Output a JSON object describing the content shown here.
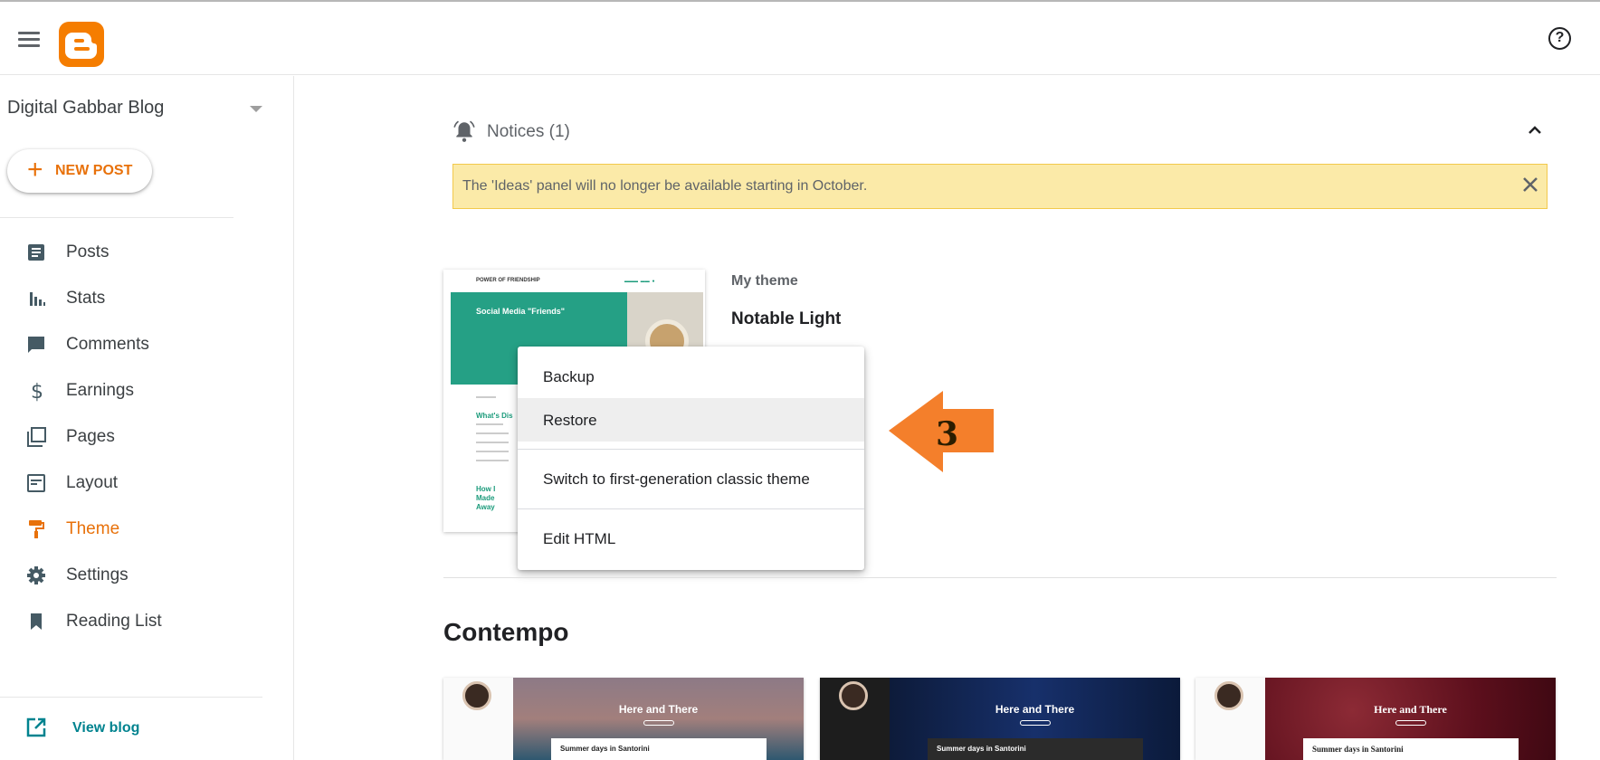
{
  "header": {
    "logo_letter": "B",
    "help_glyph": "?"
  },
  "sidebar": {
    "blog_name": "Digital Gabbar Blog",
    "new_post_label": "NEW POST",
    "items": [
      {
        "label": "Posts",
        "icon": "posts-icon"
      },
      {
        "label": "Stats",
        "icon": "stats-icon"
      },
      {
        "label": "Comments",
        "icon": "comments-icon"
      },
      {
        "label": "Earnings",
        "icon": "dollar-icon"
      },
      {
        "label": "Pages",
        "icon": "pages-icon"
      },
      {
        "label": "Layout",
        "icon": "layout-icon"
      },
      {
        "label": "Theme",
        "icon": "paint-roller-icon",
        "active": true
      },
      {
        "label": "Settings",
        "icon": "gear-icon"
      },
      {
        "label": "Reading List",
        "icon": "bookmark-icon"
      }
    ],
    "view_blog_label": "View blog"
  },
  "notices": {
    "title": "Notices (1)",
    "message": "The 'Ideas' panel will no longer be available starting in October."
  },
  "my_theme": {
    "section_label": "My theme",
    "theme_name": "Notable Light",
    "preview": {
      "blog_title": "POWER OF FRIENDSHIP",
      "featured_post": "Social Media \"Friends\"",
      "post_2": "What's Dis",
      "post_3": "How I Made Away"
    }
  },
  "menu": {
    "items": [
      "Backup",
      "Restore",
      "Switch to first-generation classic theme",
      "Edit HTML"
    ],
    "highlighted_index": 1
  },
  "annotation": {
    "step_number": "3"
  },
  "gallery": {
    "title": "Contempo",
    "cards": [
      {
        "hero_title": "Here and There",
        "post_title": "Summer days in Santorini"
      },
      {
        "hero_title": "Here and There",
        "post_title": "Summer days in Santorini"
      },
      {
        "hero_title": "Here and There",
        "post_title": "Summer days in Santorini"
      }
    ]
  },
  "colors": {
    "accent_orange": "#e8710a",
    "logo_orange": "#f57d00",
    "link_teal": "#00838f",
    "notice_bg": "#fbeaa8",
    "arrow_orange": "#f47f2b"
  }
}
